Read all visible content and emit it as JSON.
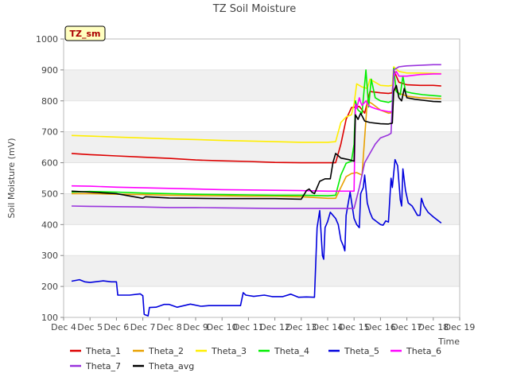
{
  "chart_data": {
    "type": "line",
    "title": "TZ Soil Moisture",
    "xlabel": "Time",
    "ylabel": "Soil Moisture (mV)",
    "badge": "TZ_sm",
    "x_unit": "days since Dec 4",
    "xlim": [
      0,
      15
    ],
    "ylim": [
      100,
      1000
    ],
    "x_ticks": [
      {
        "v": 0,
        "label": "Dec 4"
      },
      {
        "v": 1,
        "label": "Dec 5"
      },
      {
        "v": 2,
        "label": "Dec 6"
      },
      {
        "v": 3,
        "label": "Dec 7"
      },
      {
        "v": 4,
        "label": "Dec 8"
      },
      {
        "v": 5,
        "label": "Dec 9"
      },
      {
        "v": 6,
        "label": "Dec 10"
      },
      {
        "v": 7,
        "label": "Dec 11"
      },
      {
        "v": 8,
        "label": "Dec 12"
      },
      {
        "v": 9,
        "label": "Dec 13"
      },
      {
        "v": 10,
        "label": "Dec 14"
      },
      {
        "v": 11,
        "label": "Dec 15"
      },
      {
        "v": 12,
        "label": "Dec 16"
      },
      {
        "v": 13,
        "label": "Dec 17"
      },
      {
        "v": 14,
        "label": "Dec 18"
      },
      {
        "v": 15,
        "label": "Dec 19"
      }
    ],
    "y_ticks": [
      100,
      200,
      300,
      400,
      500,
      600,
      700,
      800,
      900,
      1000
    ],
    "grid_bands": true,
    "series": [
      {
        "name": "Theta_1",
        "color": "#dd0000",
        "points": [
          [
            0.3,
            630
          ],
          [
            1,
            626
          ],
          [
            2,
            622
          ],
          [
            3,
            618
          ],
          [
            4,
            614
          ],
          [
            5,
            609
          ],
          [
            6,
            606
          ],
          [
            7,
            604
          ],
          [
            8,
            601
          ],
          [
            9,
            600
          ],
          [
            10,
            600
          ],
          [
            10.3,
            600
          ],
          [
            10.5,
            660
          ],
          [
            10.7,
            740
          ],
          [
            10.9,
            778
          ],
          [
            11.2,
            782
          ],
          [
            11.4,
            760
          ],
          [
            11.6,
            830
          ],
          [
            12,
            826
          ],
          [
            12.3,
            824
          ],
          [
            12.45,
            826
          ],
          [
            12.5,
            900
          ],
          [
            12.7,
            860
          ],
          [
            13,
            852
          ],
          [
            13.5,
            850
          ],
          [
            14,
            850
          ],
          [
            14.3,
            848
          ]
        ]
      },
      {
        "name": "Theta_2",
        "color": "#e8a000",
        "points": [
          [
            0.3,
            500
          ],
          [
            1,
            500
          ],
          [
            2,
            498
          ],
          [
            3,
            497
          ],
          [
            4,
            495
          ],
          [
            5,
            494
          ],
          [
            6,
            493
          ],
          [
            7,
            492
          ],
          [
            8,
            492
          ],
          [
            9,
            490
          ],
          [
            10,
            485
          ],
          [
            10.3,
            485
          ],
          [
            10.5,
            520
          ],
          [
            10.7,
            555
          ],
          [
            10.9,
            565
          ],
          [
            11.1,
            568
          ],
          [
            11.3,
            560
          ],
          [
            11.5,
            800
          ],
          [
            11.7,
            790
          ],
          [
            12,
            770
          ],
          [
            12.3,
            760
          ],
          [
            12.45,
            762
          ],
          [
            12.5,
            840
          ],
          [
            12.7,
            825
          ],
          [
            13,
            815
          ],
          [
            13.5,
            810
          ],
          [
            14,
            808
          ],
          [
            14.3,
            807
          ]
        ]
      },
      {
        "name": "Theta_3",
        "color": "#ffee00",
        "points": [
          [
            0.3,
            688
          ],
          [
            1,
            686
          ],
          [
            2,
            683
          ],
          [
            3,
            680
          ],
          [
            4,
            677
          ],
          [
            5,
            675
          ],
          [
            6,
            672
          ],
          [
            7,
            670
          ],
          [
            8,
            668
          ],
          [
            9,
            666
          ],
          [
            10,
            666
          ],
          [
            10.3,
            668
          ],
          [
            10.5,
            730
          ],
          [
            10.7,
            748
          ],
          [
            10.9,
            755
          ],
          [
            11,
            790
          ],
          [
            11.1,
            855
          ],
          [
            11.3,
            845
          ],
          [
            11.5,
            840
          ],
          [
            11.6,
            870
          ],
          [
            11.8,
            860
          ],
          [
            12,
            850
          ],
          [
            12.3,
            848
          ],
          [
            12.45,
            850
          ],
          [
            12.5,
            910
          ],
          [
            12.7,
            895
          ],
          [
            13,
            890
          ],
          [
            13.5,
            890
          ],
          [
            14,
            889
          ],
          [
            14.3,
            888
          ]
        ]
      },
      {
        "name": "Theta_4",
        "color": "#00ee00",
        "points": [
          [
            0.3,
            505
          ],
          [
            1,
            507
          ],
          [
            2,
            505
          ],
          [
            3,
            502
          ],
          [
            4,
            500
          ],
          [
            5,
            498
          ],
          [
            6,
            497
          ],
          [
            7,
            496
          ],
          [
            8,
            495
          ],
          [
            9,
            495
          ],
          [
            10,
            493
          ],
          [
            10.3,
            495
          ],
          [
            10.5,
            560
          ],
          [
            10.7,
            598
          ],
          [
            10.9,
            605
          ],
          [
            11,
            660
          ],
          [
            11.05,
            800
          ],
          [
            11.15,
            770
          ],
          [
            11.3,
            760
          ],
          [
            11.45,
            900
          ],
          [
            11.55,
            780
          ],
          [
            11.65,
            870
          ],
          [
            11.8,
            810
          ],
          [
            12,
            800
          ],
          [
            12.3,
            795
          ],
          [
            12.45,
            800
          ],
          [
            12.5,
            905
          ],
          [
            12.6,
            830
          ],
          [
            12.75,
            820
          ],
          [
            12.85,
            880
          ],
          [
            12.95,
            830
          ],
          [
            13.2,
            825
          ],
          [
            13.6,
            820
          ],
          [
            14,
            817
          ],
          [
            14.3,
            815
          ]
        ]
      },
      {
        "name": "Theta_5",
        "color": "#0000dd",
        "points": [
          [
            0.3,
            217
          ],
          [
            0.6,
            222
          ],
          [
            0.8,
            215
          ],
          [
            1,
            213
          ],
          [
            1.5,
            218
          ],
          [
            1.8,
            215
          ],
          [
            2,
            215
          ],
          [
            2.05,
            172
          ],
          [
            2.5,
            172
          ],
          [
            2.9,
            176
          ],
          [
            3,
            170
          ],
          [
            3.05,
            110
          ],
          [
            3.1,
            108
          ],
          [
            3.2,
            105
          ],
          [
            3.25,
            132
          ],
          [
            3.5,
            133
          ],
          [
            3.8,
            142
          ],
          [
            4,
            142
          ],
          [
            4.3,
            133
          ],
          [
            4.8,
            143
          ],
          [
            5.2,
            136
          ],
          [
            5.5,
            138
          ],
          [
            6,
            138
          ],
          [
            6.5,
            138
          ],
          [
            6.7,
            138
          ],
          [
            6.8,
            180
          ],
          [
            6.9,
            172
          ],
          [
            7.2,
            168
          ],
          [
            7.6,
            172
          ],
          [
            7.9,
            167
          ],
          [
            8.3,
            167
          ],
          [
            8.6,
            175
          ],
          [
            8.9,
            165
          ],
          [
            9.2,
            166
          ],
          [
            9.5,
            165
          ],
          [
            9.6,
            390
          ],
          [
            9.7,
            445
          ],
          [
            9.8,
            300
          ],
          [
            9.85,
            288
          ],
          [
            9.9,
            390
          ],
          [
            10,
            410
          ],
          [
            10.1,
            440
          ],
          [
            10.3,
            420
          ],
          [
            10.4,
            400
          ],
          [
            10.5,
            350
          ],
          [
            10.6,
            330
          ],
          [
            10.65,
            315
          ],
          [
            10.7,
            430
          ],
          [
            10.85,
            505
          ],
          [
            11,
            420
          ],
          [
            11.1,
            400
          ],
          [
            11.2,
            390
          ],
          [
            11.25,
            500
          ],
          [
            11.35,
            520
          ],
          [
            11.4,
            560
          ],
          [
            11.5,
            470
          ],
          [
            11.6,
            440
          ],
          [
            11.7,
            420
          ],
          [
            12,
            400
          ],
          [
            12.1,
            398
          ],
          [
            12.2,
            412
          ],
          [
            12.3,
            408
          ],
          [
            12.4,
            550
          ],
          [
            12.45,
            520
          ],
          [
            12.55,
            610
          ],
          [
            12.65,
            590
          ],
          [
            12.75,
            480
          ],
          [
            12.8,
            460
          ],
          [
            12.85,
            580
          ],
          [
            12.95,
            510
          ],
          [
            13.05,
            470
          ],
          [
            13.2,
            460
          ],
          [
            13.3,
            445
          ],
          [
            13.4,
            430
          ],
          [
            13.5,
            430
          ],
          [
            13.55,
            485
          ],
          [
            13.65,
            460
          ],
          [
            13.8,
            440
          ],
          [
            14,
            425
          ],
          [
            14.3,
            405
          ]
        ]
      },
      {
        "name": "Theta_6",
        "color": "#ff00ff",
        "points": [
          [
            0.3,
            525
          ],
          [
            1,
            524
          ],
          [
            2,
            521
          ],
          [
            3,
            519
          ],
          [
            4,
            517
          ],
          [
            5,
            515
          ],
          [
            6,
            513
          ],
          [
            7,
            512
          ],
          [
            8,
            511
          ],
          [
            9,
            510
          ],
          [
            10,
            508
          ],
          [
            10.5,
            508
          ],
          [
            10.7,
            508
          ],
          [
            10.9,
            508
          ],
          [
            11,
            508
          ],
          [
            11.05,
            790
          ],
          [
            11.1,
            775
          ],
          [
            11.2,
            810
          ],
          [
            11.25,
            795
          ],
          [
            11.3,
            785
          ],
          [
            11.45,
            800
          ],
          [
            11.55,
            785
          ],
          [
            11.65,
            780
          ],
          [
            11.8,
            775
          ],
          [
            12,
            770
          ],
          [
            12.3,
            765
          ],
          [
            12.45,
            765
          ],
          [
            12.5,
            880
          ],
          [
            12.6,
            895
          ],
          [
            12.7,
            880
          ],
          [
            13,
            880
          ],
          [
            13.5,
            885
          ],
          [
            14,
            887
          ],
          [
            14.3,
            887
          ]
        ]
      },
      {
        "name": "Theta_7",
        "color": "#9933dd",
        "points": [
          [
            0.3,
            460
          ],
          [
            1,
            459
          ],
          [
            2,
            458
          ],
          [
            3,
            457
          ],
          [
            4,
            455
          ],
          [
            5,
            455
          ],
          [
            6,
            454
          ],
          [
            7,
            453
          ],
          [
            8,
            452
          ],
          [
            9,
            452
          ],
          [
            10,
            452
          ],
          [
            10.5,
            452
          ],
          [
            11,
            452
          ],
          [
            11.2,
            520
          ],
          [
            11.4,
            600
          ],
          [
            11.6,
            630
          ],
          [
            11.8,
            660
          ],
          [
            12,
            680
          ],
          [
            12.3,
            690
          ],
          [
            12.4,
            695
          ],
          [
            12.5,
            900
          ],
          [
            12.7,
            910
          ],
          [
            13,
            913
          ],
          [
            13.5,
            915
          ],
          [
            14,
            917
          ],
          [
            14.3,
            917
          ]
        ]
      },
      {
        "name": "Theta_avg",
        "color": "#000000",
        "points": [
          [
            0.3,
            508
          ],
          [
            1,
            505
          ],
          [
            2,
            500
          ],
          [
            3,
            485
          ],
          [
            3.1,
            490
          ],
          [
            4,
            486
          ],
          [
            5,
            485
          ],
          [
            6,
            484
          ],
          [
            7,
            484
          ],
          [
            8,
            484
          ],
          [
            9,
            482
          ],
          [
            9.2,
            510
          ],
          [
            9.3,
            515
          ],
          [
            9.4,
            505
          ],
          [
            9.5,
            500
          ],
          [
            9.7,
            540
          ],
          [
            9.9,
            548
          ],
          [
            10.1,
            548
          ],
          [
            10.2,
            600
          ],
          [
            10.3,
            630
          ],
          [
            10.5,
            615
          ],
          [
            10.8,
            610
          ],
          [
            11,
            605
          ],
          [
            11.05,
            755
          ],
          [
            11.15,
            740
          ],
          [
            11.25,
            760
          ],
          [
            11.4,
            735
          ],
          [
            11.6,
            730
          ],
          [
            12,
            726
          ],
          [
            12.3,
            725
          ],
          [
            12.45,
            728
          ],
          [
            12.5,
            830
          ],
          [
            12.6,
            850
          ],
          [
            12.7,
            810
          ],
          [
            12.8,
            800
          ],
          [
            12.9,
            840
          ],
          [
            13,
            810
          ],
          [
            13.3,
            805
          ],
          [
            13.6,
            802
          ],
          [
            14,
            798
          ],
          [
            14.3,
            797
          ]
        ]
      }
    ]
  }
}
